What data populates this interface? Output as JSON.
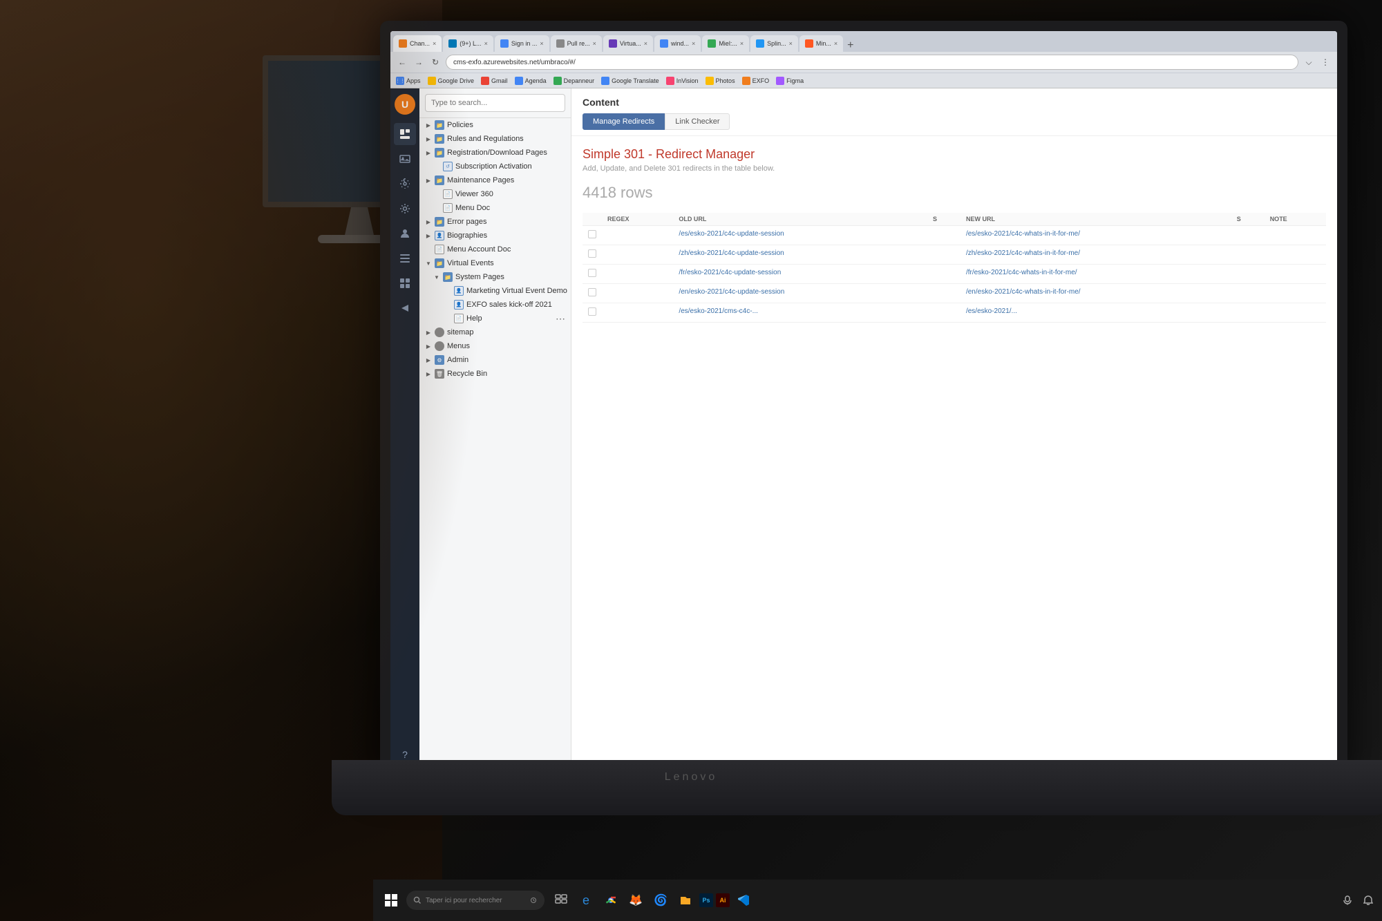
{
  "background": {
    "color": "#1a1a1a"
  },
  "laptop": {
    "brand": "Lenovo"
  },
  "browser": {
    "tabs": [
      {
        "label": "Chan...",
        "active": true,
        "favicon": "C"
      },
      {
        "label": "(9+) L...",
        "active": false,
        "favicon": "N"
      },
      {
        "label": "Sign in ...",
        "active": false,
        "favicon": "M"
      },
      {
        "label": "Pull re...",
        "active": false,
        "favicon": "G"
      },
      {
        "label": "Virtua...",
        "active": false,
        "favicon": "V"
      },
      {
        "label": "wind...",
        "active": false,
        "favicon": "G"
      },
      {
        "label": "Miel:...",
        "active": false,
        "favicon": "G"
      },
      {
        "label": "Splin...",
        "active": false,
        "favicon": "S"
      },
      {
        "label": "Min...",
        "active": false,
        "favicon": "M"
      }
    ],
    "address": "cms-exfo.azurewebsites.net/umbraco/#/",
    "bookmarks": [
      {
        "label": "Apps",
        "icon": "grid"
      },
      {
        "label": "Google Drive",
        "icon": "drive"
      },
      {
        "label": "Gmail",
        "icon": "mail"
      },
      {
        "label": "Agenda",
        "icon": "calendar"
      },
      {
        "label": "Depanneur",
        "icon": "tool"
      },
      {
        "label": "Google Translate",
        "icon": "translate"
      },
      {
        "label": "InVision",
        "icon": "inv"
      },
      {
        "label": "Photos",
        "icon": "photo"
      },
      {
        "label": "EXFO",
        "icon": "exfo"
      },
      {
        "label": "Figma",
        "icon": "figma"
      }
    ]
  },
  "cms": {
    "sidebar_icons": [
      "document",
      "image",
      "wrench",
      "gear",
      "user",
      "list",
      "grid",
      "arrow",
      "help"
    ],
    "search_placeholder": "Type to search...",
    "tree_items": [
      {
        "label": "Policies",
        "type": "folder",
        "indent": 0,
        "expanded": false
      },
      {
        "label": "Rules and Regulations",
        "type": "folder",
        "indent": 0,
        "expanded": false
      },
      {
        "label": "Registration/Download Pages",
        "type": "folder",
        "indent": 0,
        "expanded": false
      },
      {
        "label": "Subscription Activation",
        "type": "page",
        "indent": 1,
        "expanded": false
      },
      {
        "label": "Maintenance Pages",
        "type": "folder",
        "indent": 0,
        "expanded": false
      },
      {
        "label": "Viewer 360",
        "type": "doc",
        "indent": 1
      },
      {
        "label": "Menu Doc",
        "type": "doc",
        "indent": 1
      },
      {
        "label": "Error pages",
        "type": "folder",
        "indent": 0,
        "expanded": false
      },
      {
        "label": "Biographies",
        "type": "page",
        "indent": 0,
        "expanded": false
      },
      {
        "label": "Menu Account Doc",
        "type": "doc",
        "indent": 0
      },
      {
        "label": "Virtual Events",
        "type": "folder",
        "indent": 0,
        "expanded": true
      },
      {
        "label": "System Pages",
        "type": "folder",
        "indent": 1,
        "expanded": true
      },
      {
        "label": "Marketing Virtual Event Demo",
        "type": "page",
        "indent": 2
      },
      {
        "label": "EXFO sales kick-off 2021",
        "type": "page",
        "indent": 2
      },
      {
        "label": "Help",
        "type": "doc",
        "indent": 2
      },
      {
        "label": "sitemap",
        "type": "special",
        "indent": 0
      },
      {
        "label": "Menus",
        "type": "folder",
        "indent": 0,
        "expanded": false
      },
      {
        "label": "Admin",
        "type": "folder",
        "indent": 0,
        "expanded": false
      },
      {
        "label": "Recycle Bin",
        "type": "folder",
        "indent": 0
      }
    ]
  },
  "content": {
    "title": "Content",
    "tabs": [
      {
        "label": "Manage Redirects",
        "active": true
      },
      {
        "label": "Link Checker",
        "active": false
      }
    ],
    "redirect_manager": {
      "title": "Simple 301 - Redirect Manager",
      "subtitle": "Add, Update, and Delete 301 redirects in the table below.",
      "rows_count": "4418 rows",
      "table_headers": [
        "REGEX",
        "OLD URL",
        "S",
        "NEW URL",
        "S",
        "NOTE"
      ],
      "rows": [
        {
          "old_url": "/es/esko-2021/c4c-update-session",
          "new_url": "/es/esko-2021/c4c-whats-in-it-for-me/"
        },
        {
          "old_url": "/zh/esko-2021/c4c-update-session",
          "new_url": "/zh/esko-2021/c4c-whats-in-it-for-me/"
        },
        {
          "old_url": "/fr/esko-2021/c4c-update-session",
          "new_url": "/fr/esko-2021/c4c-whats-in-it-for-me/"
        },
        {
          "old_url": "/en/esko-2021/c4c-update-session",
          "new_url": "/en/esko-2021/c4c-whats-in-it-for-me/"
        },
        {
          "old_url": "/es/esko-2021/cms-c4c-...",
          "new_url": "/es/esko-2021/..."
        }
      ]
    }
  },
  "taskbar": {
    "search_placeholder": "Taper ici pour rechercher",
    "apps": [
      "🪟",
      "🔍",
      "📁",
      "🌐",
      "🦊",
      "🌀",
      "🗂️",
      "🎨",
      "🎯"
    ],
    "time": "...",
    "mic_icon": "mic"
  }
}
